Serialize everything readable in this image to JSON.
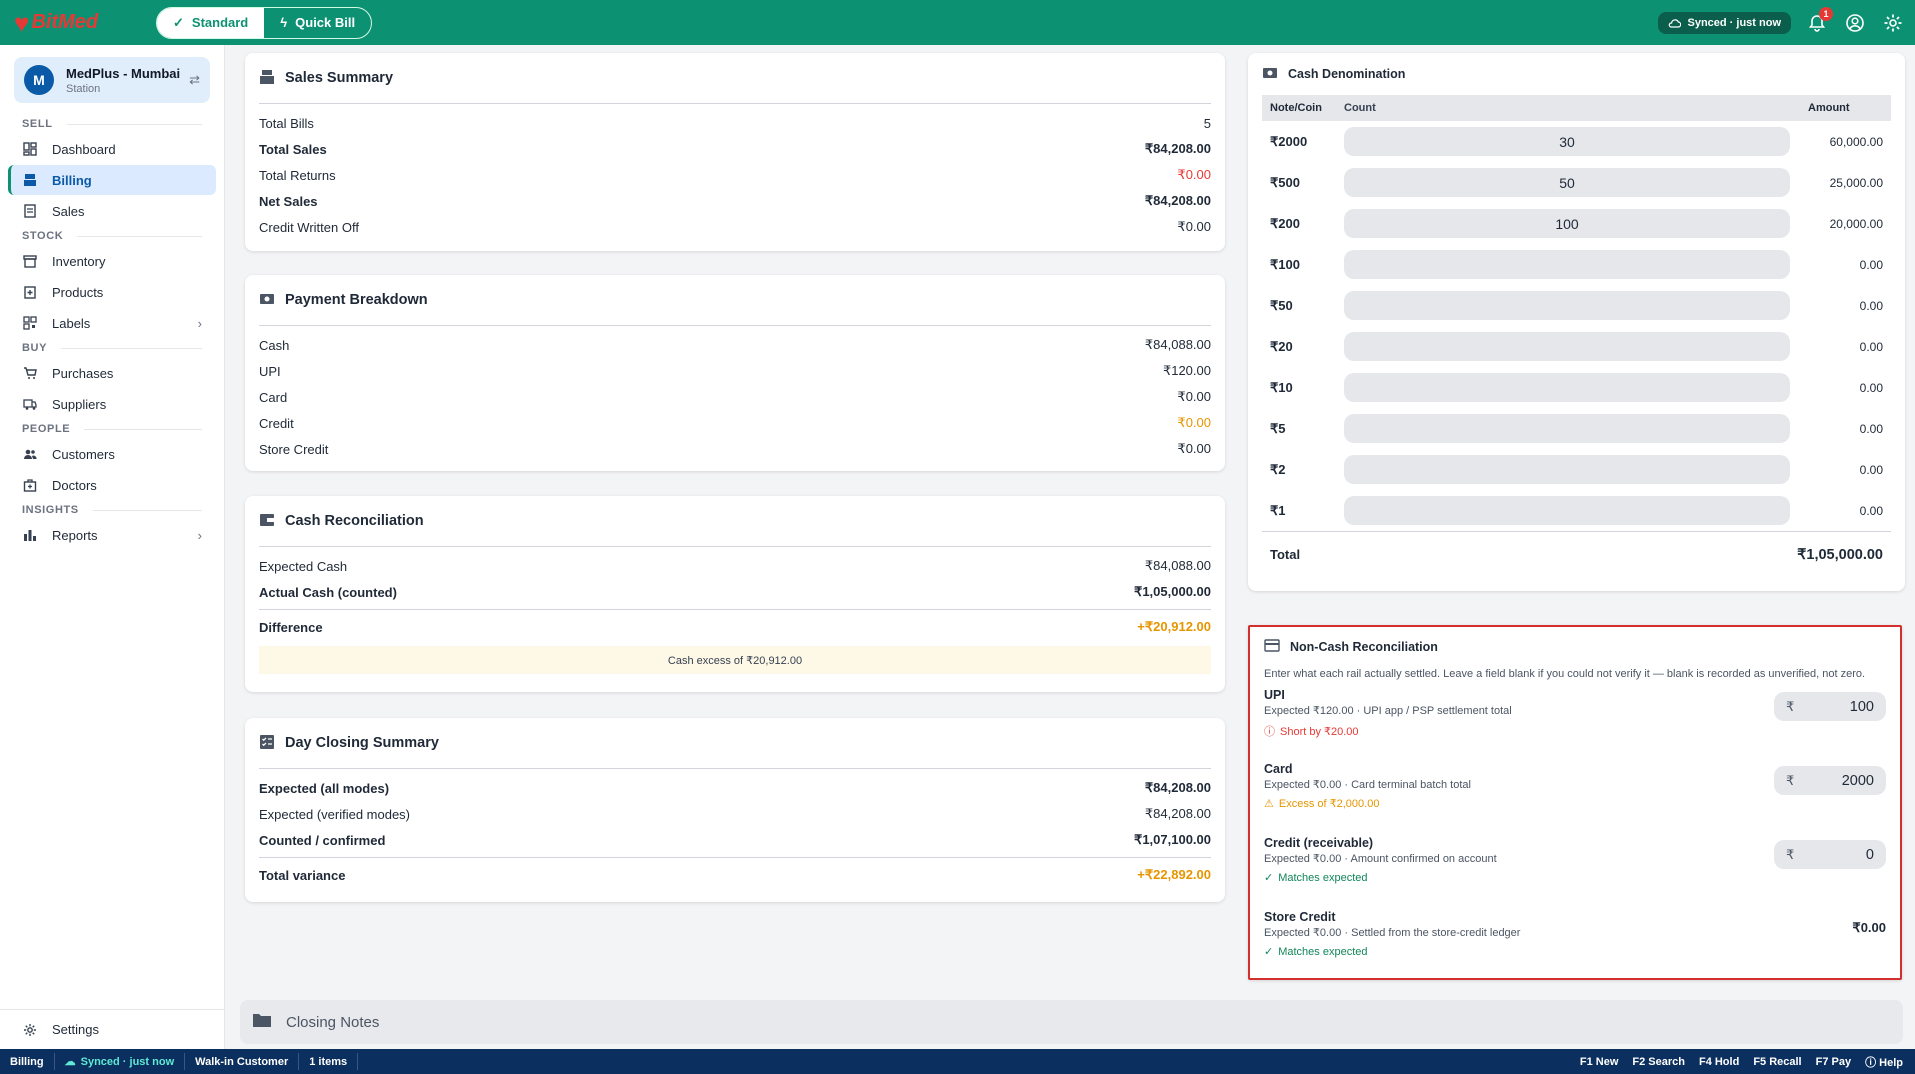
{
  "topbar": {
    "logo_text": "BitMed",
    "mode_standard": "Standard",
    "mode_quickbill": "Quick Bill",
    "sync_status": "Synced · just now",
    "notification_count": "1",
    "brand_color": "#0d9173"
  },
  "sidebar": {
    "station_initial": "M",
    "station_name": "MedPlus - Mumbai",
    "station_sub": "Station",
    "sections": {
      "sell": "SELL",
      "stock": "STOCK",
      "buy": "BUY",
      "people": "PEOPLE",
      "insights": "INSIGHTS"
    },
    "items": {
      "dashboard": "Dashboard",
      "billing": "Billing",
      "sales": "Sales",
      "inventory": "Inventory",
      "products": "Products",
      "labels": "Labels",
      "purchases": "Purchases",
      "suppliers": "Suppliers",
      "customers": "Customers",
      "doctors": "Doctors",
      "reports": "Reports",
      "settings": "Settings"
    }
  },
  "sales_summary": {
    "title": "Sales Summary",
    "rows": [
      {
        "label": "Total Bills",
        "value": "5"
      },
      {
        "label": "Total Sales",
        "value": "₹84,208.00"
      },
      {
        "label": "Total Returns",
        "value": "₹0.00"
      },
      {
        "label": "Net Sales",
        "value": "₹84,208.00"
      },
      {
        "label": "Credit Written Off",
        "value": "₹0.00"
      }
    ]
  },
  "payment_breakdown": {
    "title": "Payment Breakdown",
    "rows": [
      {
        "label": "Cash",
        "value": "₹84,088.00"
      },
      {
        "label": "UPI",
        "value": "₹120.00"
      },
      {
        "label": "Card",
        "value": "₹0.00"
      },
      {
        "label": "Credit",
        "value": "₹0.00"
      },
      {
        "label": "Store Credit",
        "value": "₹0.00"
      }
    ]
  },
  "cash_reconciliation": {
    "title": "Cash Reconciliation",
    "expected_label": "Expected Cash",
    "expected_value": "₹84,088.00",
    "actual_label": "Actual Cash (counted)",
    "actual_value": "₹1,05,000.00",
    "difference_label": "Difference",
    "difference_value": "+₹20,912.00",
    "alert": "Cash excess of ₹20,912.00"
  },
  "day_closing": {
    "title": "Day Closing Summary",
    "rows": [
      {
        "label": "Expected (all modes)",
        "value": "₹84,208.00"
      },
      {
        "label": "Expected (verified modes)",
        "value": "₹84,208.00"
      },
      {
        "label": "Counted / confirmed",
        "value": "₹1,07,100.00"
      }
    ],
    "variance_label": "Total variance",
    "variance_value": "+₹22,892.00"
  },
  "cash_denomination": {
    "title": "Cash Denomination",
    "headers": {
      "note": "Note/Coin",
      "count": "Count",
      "amount": "Amount"
    },
    "rows": [
      {
        "note": "₹2000",
        "count": "30",
        "amount": "60,000.00"
      },
      {
        "note": "₹500",
        "count": "50",
        "amount": "25,000.00"
      },
      {
        "note": "₹200",
        "count": "100",
        "amount": "20,000.00"
      },
      {
        "note": "₹100",
        "count": "",
        "amount": "0.00"
      },
      {
        "note": "₹50",
        "count": "",
        "amount": "0.00"
      },
      {
        "note": "₹20",
        "count": "",
        "amount": "0.00"
      },
      {
        "note": "₹10",
        "count": "",
        "amount": "0.00"
      },
      {
        "note": "₹5",
        "count": "",
        "amount": "0.00"
      },
      {
        "note": "₹2",
        "count": "",
        "amount": "0.00"
      },
      {
        "note": "₹1",
        "count": "",
        "amount": "0.00"
      }
    ],
    "total_label": "Total",
    "total_value": "₹1,05,000.00"
  },
  "non_cash": {
    "title": "Non-Cash Reconciliation",
    "description": "Enter what each rail actually settled. Leave a field blank if you could not verify it — blank is recorded as unverified, not zero.",
    "currency": "₹",
    "rails": [
      {
        "name": "UPI",
        "expected": "Expected ₹120.00 · UPI app / PSP settlement total",
        "status": "Short by ₹20.00",
        "value": "100"
      },
      {
        "name": "Card",
        "expected": "Expected ₹0.00 · Card terminal batch total",
        "status": "Excess of ₹2,000.00",
        "value": "2000"
      },
      {
        "name": "Credit (receivable)",
        "expected": "Expected ₹0.00 · Amount confirmed on account",
        "status": "Matches expected",
        "value": "0"
      },
      {
        "name": "Store Credit",
        "expected": "Expected ₹0.00 · Settled from the store-credit ledger",
        "status": "Matches expected",
        "value": "₹0.00"
      }
    ]
  },
  "closing_notes": {
    "title": "Closing Notes"
  },
  "statusbar": {
    "page": "Billing",
    "sync": "Synced · just now",
    "customer": "Walk-in Customer",
    "items": "1 items",
    "shortcuts": [
      "F1 New",
      "F2 Search",
      "F4 Hold",
      "F5 Recall",
      "F7 Pay"
    ],
    "help": "Help"
  }
}
